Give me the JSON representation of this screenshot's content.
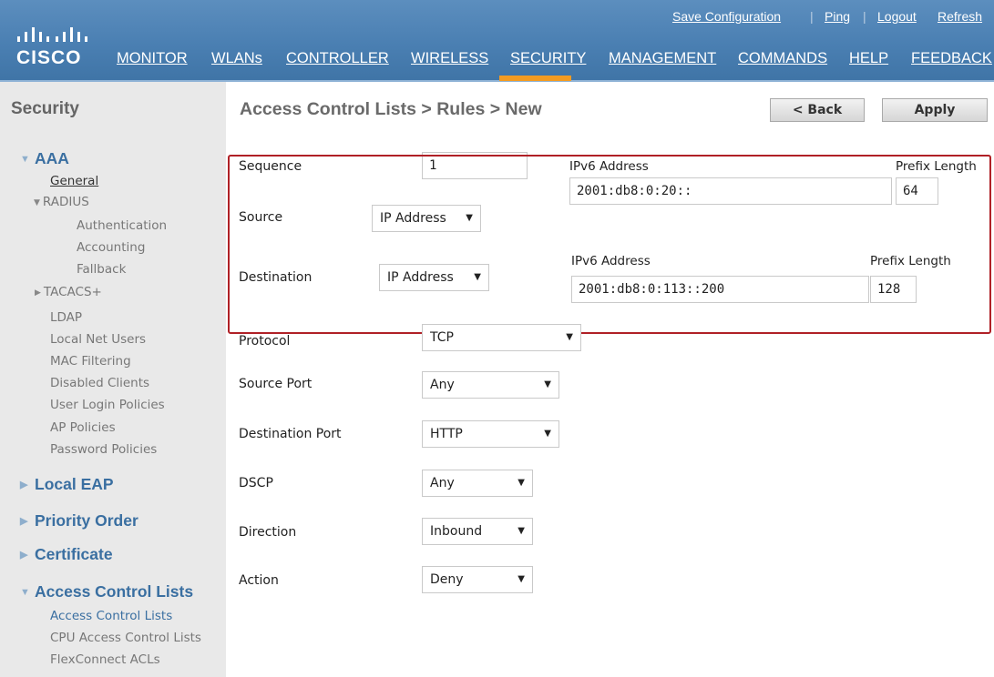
{
  "header": {
    "logo_text": "CISCO",
    "nav": [
      "MONITOR",
      "WLANs",
      "CONTROLLER",
      "WIRELESS",
      "SECURITY",
      "MANAGEMENT",
      "COMMANDS",
      "HELP",
      "FEEDBACK"
    ],
    "active_nav": "SECURITY",
    "top_links": [
      "Save Configuration",
      "Ping",
      "Logout",
      "Refresh"
    ],
    "colors": {
      "background": "#4a7fb2",
      "active_tab": "#f39b22"
    }
  },
  "sidebar": {
    "title": "Security",
    "aaa": {
      "label": "AAA",
      "general": "General",
      "radius": "RADIUS",
      "radius_items": [
        "Authentication",
        "Accounting",
        "Fallback"
      ],
      "tacacs": "TACACS+",
      "items": [
        "LDAP",
        "Local Net Users",
        "MAC Filtering",
        "Disabled Clients",
        "User Login Policies",
        "AP Policies",
        "Password Policies"
      ]
    },
    "sections": [
      "Local EAP",
      "Priority Order",
      "Certificate"
    ],
    "acl": {
      "label": "Access Control Lists",
      "items": [
        "Access Control Lists",
        "CPU Access Control Lists",
        "FlexConnect ACLs"
      ]
    }
  },
  "main": {
    "title": "Access Control Lists > Rules > New",
    "back_button": "< Back",
    "apply_button": "Apply",
    "sequence": {
      "label": "Sequence",
      "value": "1"
    },
    "source": {
      "label": "Source",
      "type": "IP Address",
      "addr_label": "IPv6 Address",
      "addr": "2001:db8:0:20::",
      "prefix_label": "Prefix Length",
      "prefix": "64"
    },
    "destination": {
      "label": "Destination",
      "type": "IP Address",
      "addr_label": "IPv6 Address",
      "addr": "2001:db8:0:113::200",
      "prefix_label": "Prefix Length",
      "prefix": "128"
    },
    "protocol": {
      "label": "Protocol",
      "value": "TCP"
    },
    "source_port": {
      "label": "Source Port",
      "value": "Any"
    },
    "destination_port": {
      "label": "Destination Port",
      "value": "HTTP"
    },
    "dscp": {
      "label": "DSCP",
      "value": "Any"
    },
    "direction": {
      "label": "Direction",
      "value": "Inbound"
    },
    "action": {
      "label": "Action",
      "value": "Deny"
    }
  }
}
